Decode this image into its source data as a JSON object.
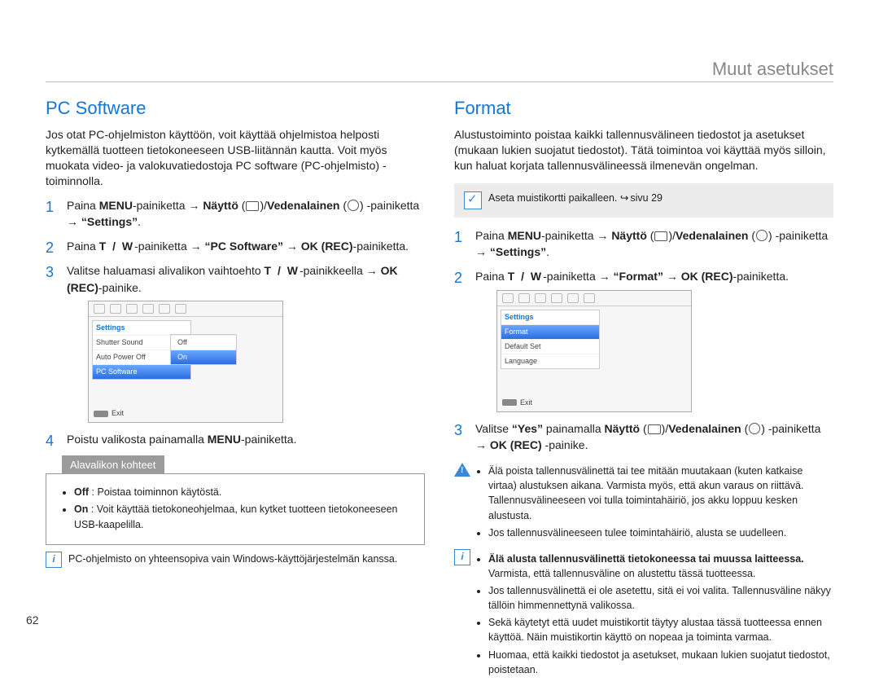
{
  "page_number": "62",
  "header": "Muut asetukset",
  "left": {
    "title": "PC Software",
    "intro": "Jos otat PC-ohjelmiston käyttöön, voit käyttää ohjelmistoa helposti kytkemällä tuotteen tietokoneeseen USB-liitännän kautta. Voit myös muokata video- ja valokuvatiedostoja PC software (PC-ohjelmisto) -toiminnolla.",
    "s1_num": "1",
    "s1_a": "Paina ",
    "s1_menu": "MENU",
    "s1_b": "-painiketta ",
    "s1_display": "Näyttö",
    "s1_slash": "/",
    "s1_uw": "Vedenalainen",
    "s1_c": " -painiketta ",
    "s1_settings": "“Settings”",
    "s1_dot": ".",
    "s2_num": "2",
    "s2_a": "Paina ",
    "s2_tw": "T / W",
    "s2_b": "-painiketta ",
    "s2_target": "“PC Software”",
    "s2_ok": "OK (REC)",
    "s2_c": "-painiketta.",
    "s3_num": "3",
    "s3_a": "Valitse haluamasi alivalikon vaihtoehto ",
    "s3_tw": "T / W",
    "s3_b": "-painikkeella ",
    "s3_ok": "OK (REC)",
    "s3_c": "-painike.",
    "lcd": {
      "heading": "Settings",
      "r1": "Shutter Sound",
      "r2": "Auto Power Off",
      "r3": "PC Software",
      "off": "Off",
      "on": "On",
      "exit": "Exit"
    },
    "s4_num": "4",
    "s4_a": "Poistu valikosta painamalla ",
    "s4_menu": "MENU",
    "s4_b": "-painiketta.",
    "sub_hdr": "Alavalikon kohteet",
    "sub_off_b": "Off",
    "sub_off": " : Poistaa toiminnon käytöstä.",
    "sub_on_b": "On",
    "sub_on": " : Voit käyttää tietokoneohjelmaa, kun kytket tuotteen tietokoneeseen USB-kaapelilla.",
    "note": "PC-ohjelmisto on yhteensopiva vain Windows-käyttöjärjestelmän kanssa."
  },
  "right": {
    "title": "Format",
    "intro": "Alustustoiminto poistaa kaikki tallennusvälineen tiedostot ja asetukset (mukaan lukien suojatut tiedostot). Tätä toimintoa voi käyttää myös silloin, kun haluat korjata tallennusvälineessä ilmenevän ongelman.",
    "info_a": "Aseta muistikortti paikalleen. ",
    "info_b": "sivu 29",
    "s1_num": "1",
    "s1_a": "Paina ",
    "s1_menu": "MENU",
    "s1_b": "-painiketta ",
    "s1_display": "Näyttö",
    "s1_slash": "/",
    "s1_uw": "Vedenalainen",
    "s1_c": " -painiketta ",
    "s1_settings": "“Settings”",
    "s1_dot": ".",
    "s2_num": "2",
    "s2_a": "Paina ",
    "s2_tw": "T / W",
    "s2_b": "-painiketta ",
    "s2_target": "“Format”",
    "s2_ok": "OK (REC)",
    "s2_c": "-painiketta.",
    "lcd": {
      "heading": "Settings",
      "r1": "Format",
      "r2": "Default Set",
      "r3": "Language",
      "exit": "Exit"
    },
    "s3_num": "3",
    "s3_a": "Valitse ",
    "s3_yes": "“Yes”",
    "s3_b": " painamalla ",
    "s3_display": "Näyttö",
    "s3_slash": "/",
    "s3_uw": "Vedenalainen",
    "s3_c": " -painiketta ",
    "s3_ok": "OK (REC)",
    "s3_d": " -painike.",
    "warn1": "Älä poista tallennusvälinettä tai tee mitään muutakaan (kuten katkaise virtaa) alustuksen aikana. Varmista myös, että akun varaus on riittävä. Tallennusvälineeseen voi tulla toimintahäiriö, jos akku loppuu kesken alustusta.",
    "warn2": "Jos tallennusvälineeseen tulee toimintahäiriö, alusta se uudelleen.",
    "note1_b": "Älä alusta tallennusvälinettä tietokoneessa tai muussa laitteessa.",
    "note1": " Varmista, että tallennusväline on alustettu tässä tuotteessa.",
    "note2": "Jos tallennusvälinettä ei ole asetettu, sitä ei voi valita. Tallennusväline näkyy tällöin himmennettynä valikossa.",
    "note3": "Sekä käytetyt että uudet muistikortit täytyy alustaa tässä tuotteessa ennen käyttöä. Näin muistikortin käyttö on nopeaa ja toiminta varmaa.",
    "note4": "Huomaa, että kaikki tiedostot ja asetukset, mukaan lukien suojatut tiedostot, poistetaan."
  }
}
